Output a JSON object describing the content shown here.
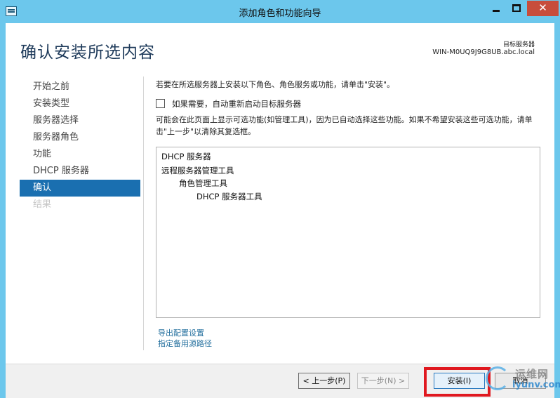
{
  "window": {
    "title": "添加角色和功能向导",
    "close_glyph": "✕"
  },
  "header": {
    "page_title": "确认安装所选内容",
    "destination_label": "目标服务器",
    "destination_server": "WIN-M0UQ9J9G8UB.abc.local"
  },
  "nav": {
    "items": [
      {
        "label": "开始之前",
        "state": "normal"
      },
      {
        "label": "安装类型",
        "state": "normal"
      },
      {
        "label": "服务器选择",
        "state": "normal"
      },
      {
        "label": "服务器角色",
        "state": "normal"
      },
      {
        "label": "功能",
        "state": "normal"
      },
      {
        "label": "DHCP 服务器",
        "state": "normal"
      },
      {
        "label": "确认",
        "state": "active"
      },
      {
        "label": "结果",
        "state": "disabled"
      }
    ]
  },
  "main": {
    "intro_text": "若要在所选服务器上安装以下角色、角色服务或功能，请单击\"安装\"。",
    "restart_checkbox": {
      "label": "如果需要，自动重新启动目标服务器",
      "checked": false
    },
    "note_text": "可能会在此页面上显示可选功能(如管理工具)，因为已自动选择这些功能。如果不希望安装这些可选功能，请单击\"上一步\"以清除其复选框。",
    "selection_list": [
      {
        "label": "DHCP 服务器",
        "level": 0
      },
      {
        "label": "远程服务器管理工具",
        "level": 0
      },
      {
        "label": "角色管理工具",
        "level": 1
      },
      {
        "label": "DHCP 服务器工具",
        "level": 2
      }
    ],
    "links": {
      "export": "导出配置设置",
      "alternate_source": "指定备用源路径"
    }
  },
  "footer": {
    "prev_label": "< 上一步(P)",
    "next_label": "下一步(N) >",
    "install_label": "安装(I)",
    "cancel_label": "取消",
    "highlight_color": "#e0181f"
  },
  "watermark": {
    "cn_text": "运维网",
    "en_text": "iyunv.com"
  },
  "colors": {
    "titlebar": "#6cc7ec",
    "close_button": "#c74d3c",
    "nav_active": "#1a6fb0",
    "link": "#236f9e"
  }
}
